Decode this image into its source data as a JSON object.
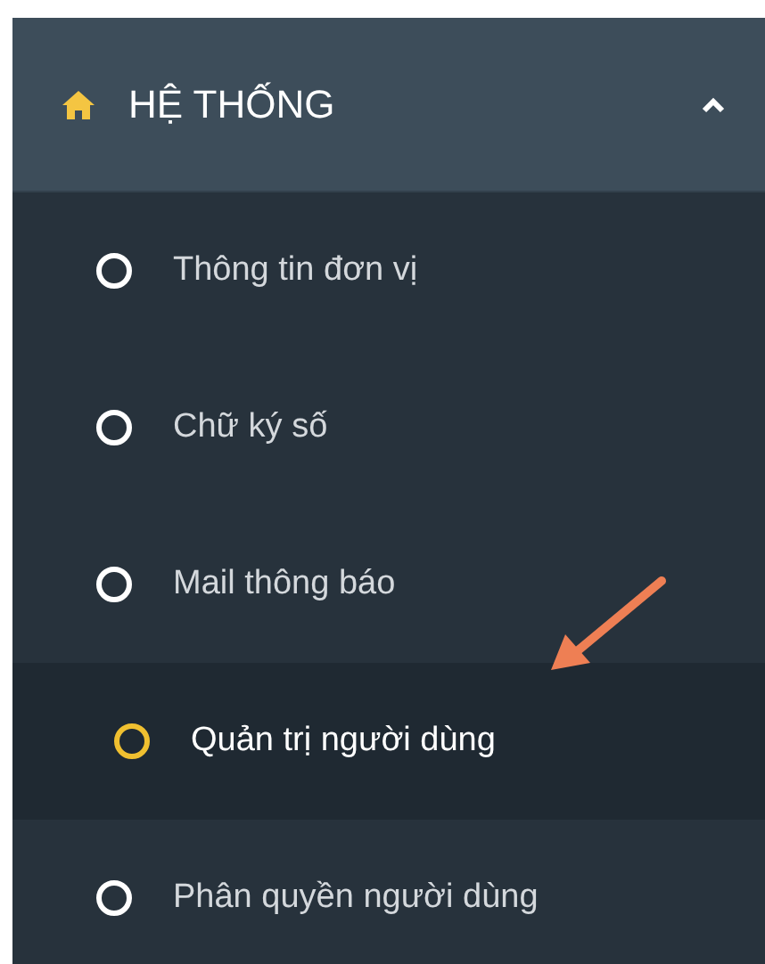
{
  "menu_group": {
    "title": "HỆ THỐNG",
    "expanded": true,
    "items": [
      {
        "label": "Thông tin đơn vị",
        "selected": false
      },
      {
        "label": "Chữ ký số",
        "selected": false
      },
      {
        "label": "Mail thông báo",
        "selected": false
      },
      {
        "label": "Quản trị người dùng",
        "selected": true
      },
      {
        "label": "Phân quyền người dùng",
        "selected": false
      }
    ]
  }
}
